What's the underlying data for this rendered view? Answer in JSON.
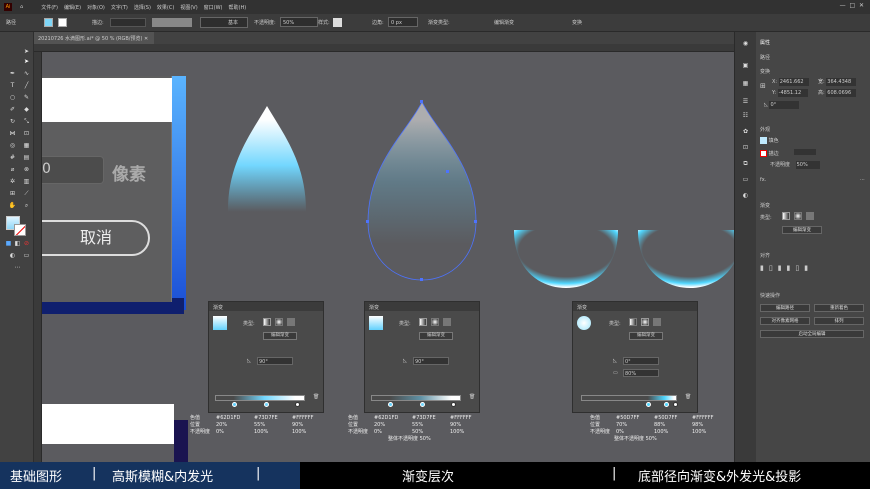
{
  "menubar": {
    "items": [
      "文件(F)",
      "编辑(E)",
      "对象(O)",
      "文字(T)",
      "选择(S)",
      "效果(C)",
      "视图(V)",
      "窗口(W)",
      "帮助(H)"
    ]
  },
  "control": {
    "label_left": "路径",
    "stroke_label": "描边:",
    "line_style": "基本",
    "opacity_label": "不透明度:",
    "opacity_value": "50%",
    "style_label": "样式:",
    "corner_label": "边角:",
    "corner_value": "0 px",
    "gradient_type_label": "渐变类型:",
    "edit_gradient": "编辑渐变",
    "transform": "变换"
  },
  "document_tab": {
    "title": "20210726 水滴图形.ai* @ 50 % (RGB/预览)"
  },
  "canvas": {
    "pixel_label": "像素",
    "cancel_label": "取消"
  },
  "properties": {
    "tab": "属性",
    "section_path": "路径",
    "section_transform": "变换",
    "x_label": "X:",
    "x_value": "2461.662",
    "y_label": "Y:",
    "y_value": "-4851.12",
    "w_label": "宽:",
    "w_value": "364.4348",
    "h_label": "高:",
    "h_value": "608.0696",
    "angle_value": "0°",
    "section_appearance": "外观",
    "fill_label": "填色",
    "stroke_label": "描边",
    "opacity_label": "不透明度",
    "opacity_value": "50%",
    "fx": "fx.",
    "section_gradient": "渐变",
    "type_label": "类型:",
    "edit_gradient": "编辑渐变",
    "section_align": "对齐",
    "section_quick": "快速操作",
    "quick_buttons": [
      "编辑路径",
      "重新着色",
      "对齐像素网格",
      "排列"
    ],
    "auto_select": "启动全局编辑"
  },
  "gradient_panels": [
    {
      "tab": "渐变",
      "type_label": "类型:",
      "edit_btn": "编辑渐变",
      "angle": "90°",
      "colors": [
        "#62D1FD",
        "#73D7FE",
        "#FFFFFF"
      ],
      "positions": [
        "20%",
        "55%",
        "90%"
      ],
      "opacities": [
        "0%",
        "100%",
        "100%"
      ],
      "row_labels": [
        "色值",
        "位置",
        "不透明度"
      ]
    },
    {
      "tab": "渐变",
      "type_label": "类型:",
      "edit_btn": "编辑渐变",
      "angle": "90°",
      "colors": [
        "#62D1FD",
        "#73D7FE",
        "#FFFFFF"
      ],
      "positions": [
        "20%",
        "55%",
        "90%"
      ],
      "opacities": [
        "0%",
        "50%",
        "100%"
      ],
      "row_labels": [
        "色值",
        "位置",
        "不透明度"
      ],
      "note": "整体不透明度 50%"
    },
    {
      "tab": "渐变",
      "type_label": "类型:",
      "edit_btn": "编辑渐变",
      "angle": "0°",
      "scale": "80%",
      "colors": [
        "#50D7FF",
        "#50D7FF",
        "#FFFFFF"
      ],
      "positions": [
        "70%",
        "88%",
        "98%"
      ],
      "opacities": [
        "0%",
        "100%",
        "100%"
      ],
      "row_labels": [
        "色值",
        "位置",
        "不透明度"
      ],
      "note": "整体不透明度 50%"
    }
  ],
  "bottom_bar": {
    "left": "基础图形",
    "mid": "高斯模糊&内发光",
    "center": "渐变层次",
    "right": "底部径向渐变&外发光&投影",
    "separator": "|"
  }
}
